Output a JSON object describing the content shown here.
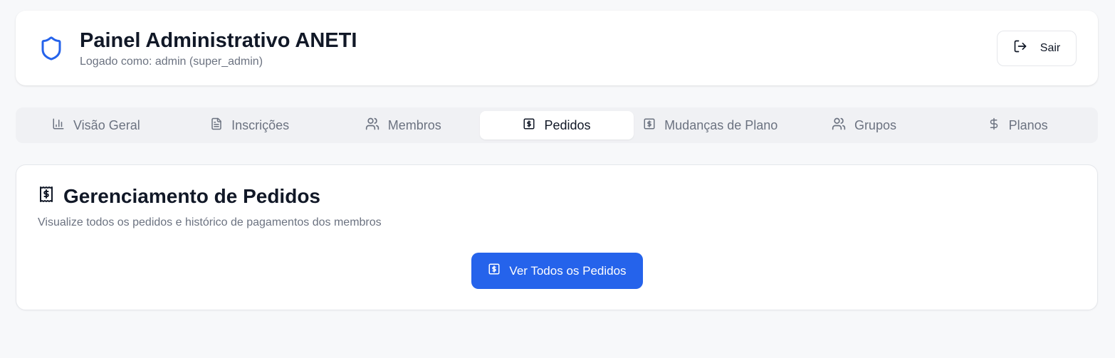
{
  "header": {
    "title": "Painel Administrativo ANETI",
    "subtitle": "Logado como: admin (super_admin)",
    "logout_label": "Sair",
    "icon": "shield-icon",
    "accent": "#2563eb"
  },
  "tabs": [
    {
      "label": "Visão Geral",
      "icon": "bar-chart-icon",
      "active": false
    },
    {
      "label": "Inscrições",
      "icon": "file-text-icon",
      "active": false
    },
    {
      "label": "Membros",
      "icon": "users-icon",
      "active": false
    },
    {
      "label": "Pedidos",
      "icon": "receipt-icon",
      "active": true
    },
    {
      "label": "Mudanças de Plano",
      "icon": "receipt-icon",
      "active": false
    },
    {
      "label": "Grupos",
      "icon": "users-icon",
      "active": false
    },
    {
      "label": "Planos",
      "icon": "dollar-icon",
      "active": false
    }
  ],
  "main": {
    "title": "Gerenciamento de Pedidos",
    "description": "Visualize todos os pedidos e histórico de pagamentos dos membros",
    "button_label": "Ver Todos os Pedidos",
    "button_color": "#2563eb"
  }
}
